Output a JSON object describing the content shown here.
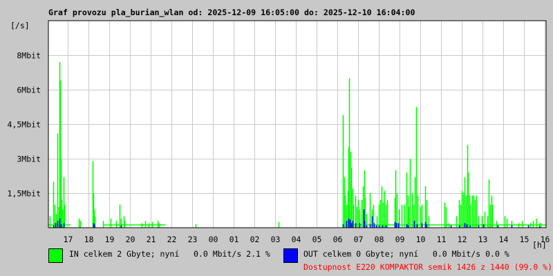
{
  "chart_data": {
    "type": "bar",
    "title": "Graf provozu pla_burian_wlan od: 2025-12-09 16:05:00 do: 2025-12-10 16:04:00",
    "ylabel": "[/s]",
    "xlabel": "[h]",
    "x_unit": "minutes since 16:05",
    "x_range": [
      0,
      1440
    ],
    "ylim": [
      0,
      9
    ],
    "y_ticks": [
      {
        "value": 1.5,
        "label": "1,5Mbit"
      },
      {
        "value": 3,
        "label": "3Mbit"
      },
      {
        "value": 4.5,
        "label": "4,5Mbit"
      },
      {
        "value": 6,
        "label": "6Mbit"
      },
      {
        "value": 7.5,
        "label": "8Mbit"
      }
    ],
    "x_ticks": [
      "17",
      "18",
      "19",
      "20",
      "21",
      "22",
      "23",
      "00",
      "01",
      "02",
      "03",
      "04",
      "05",
      "06",
      "07",
      "08",
      "09",
      "10",
      "11",
      "12",
      "13",
      "14",
      "15",
      "16"
    ],
    "grid": true,
    "colors": {
      "in": "#00ff00",
      "out": "#0000ff",
      "availability": "#ff0000",
      "grid": "#c8c8c8",
      "background": "#c8c8c8"
    },
    "series": [
      {
        "name": "IN",
        "baseline": [
          [
            0,
            64,
            0.12
          ],
          [
            160,
            340,
            0.12
          ],
          [
            850,
            1440,
            0.12
          ]
        ],
        "peaks": [
          [
            4,
            0.5
          ],
          [
            14,
            2.0
          ],
          [
            18,
            1.0
          ],
          [
            22,
            0.6
          ],
          [
            26,
            4.1
          ],
          [
            30,
            0.9
          ],
          [
            32,
            7.2
          ],
          [
            34,
            6.4
          ],
          [
            36,
            3.0
          ],
          [
            38,
            1.2
          ],
          [
            40,
            0.8
          ],
          [
            44,
            2.2
          ],
          [
            46,
            1.0
          ],
          [
            88,
            0.4
          ],
          [
            92,
            0.3
          ],
          [
            128,
            2.9
          ],
          [
            130,
            1.5
          ],
          [
            132,
            0.8
          ],
          [
            134,
            0.5
          ],
          [
            158,
            0.3
          ],
          [
            180,
            0.4
          ],
          [
            196,
            0.3
          ],
          [
            206,
            1.0
          ],
          [
            210,
            0.4
          ],
          [
            218,
            0.5
          ],
          [
            220,
            0.3
          ],
          [
            270,
            0.2
          ],
          [
            280,
            0.3
          ],
          [
            290,
            0.2
          ],
          [
            300,
            0.25
          ],
          [
            316,
            0.3
          ],
          [
            320,
            0.2
          ],
          [
            426,
            0.15
          ],
          [
            666,
            0.25
          ],
          [
            852,
            4.9
          ],
          [
            856,
            2.2
          ],
          [
            858,
            1.4
          ],
          [
            862,
            1.0
          ],
          [
            866,
            1.6
          ],
          [
            868,
            3.5
          ],
          [
            870,
            6.5
          ],
          [
            874,
            3.3
          ],
          [
            876,
            2.6
          ],
          [
            880,
            1.7
          ],
          [
            882,
            1.0
          ],
          [
            888,
            1.4
          ],
          [
            892,
            0.9
          ],
          [
            896,
            1.2
          ],
          [
            900,
            0.8
          ],
          [
            906,
            1.2
          ],
          [
            910,
            1.8
          ],
          [
            914,
            2.5
          ],
          [
            916,
            1.3
          ],
          [
            920,
            0.6
          ],
          [
            930,
            1.5
          ],
          [
            936,
            0.8
          ],
          [
            940,
            1.0
          ],
          [
            950,
            0.5
          ],
          [
            956,
            1.0
          ],
          [
            960,
            1.2
          ],
          [
            964,
            1.8
          ],
          [
            968,
            1.1
          ],
          [
            972,
            1.6
          ],
          [
            976,
            1.0
          ],
          [
            980,
            1.2
          ],
          [
            1002,
            1.3
          ],
          [
            1004,
            2.5
          ],
          [
            1008,
            1.5
          ],
          [
            1014,
            0.8
          ],
          [
            1022,
            1.0
          ],
          [
            1030,
            1.0
          ],
          [
            1036,
            2.4
          ],
          [
            1040,
            1.4
          ],
          [
            1042,
            0.9
          ],
          [
            1046,
            3.0
          ],
          [
            1052,
            1.5
          ],
          [
            1056,
            1.0
          ],
          [
            1060,
            2.2
          ],
          [
            1064,
            5.25
          ],
          [
            1068,
            1.4
          ],
          [
            1076,
            0.9
          ],
          [
            1080,
            1.0
          ],
          [
            1090,
            1.8
          ],
          [
            1094,
            1.2
          ],
          [
            1100,
            0.5
          ],
          [
            1146,
            1.1
          ],
          [
            1150,
            0.9
          ],
          [
            1158,
            0.2
          ],
          [
            1180,
            0.5
          ],
          [
            1188,
            1.2
          ],
          [
            1192,
            1.0
          ],
          [
            1196,
            1.6
          ],
          [
            1200,
            1.5
          ],
          [
            1204,
            2.2
          ],
          [
            1208,
            1.4
          ],
          [
            1212,
            3.6
          ],
          [
            1214,
            2.4
          ],
          [
            1218,
            1.4
          ],
          [
            1220,
            1.0
          ],
          [
            1226,
            1.4
          ],
          [
            1230,
            1.4
          ],
          [
            1234,
            1.2
          ],
          [
            1238,
            1.4
          ],
          [
            1244,
            0.5
          ],
          [
            1254,
            0.5
          ],
          [
            1262,
            0.7
          ],
          [
            1270,
            0.5
          ],
          [
            1274,
            2.1
          ],
          [
            1278,
            1.0
          ],
          [
            1282,
            1.4
          ],
          [
            1284,
            1.0
          ],
          [
            1296,
            0.3
          ],
          [
            1320,
            0.5
          ],
          [
            1326,
            0.4
          ],
          [
            1340,
            0.3
          ],
          [
            1360,
            0.2
          ],
          [
            1370,
            0.3
          ],
          [
            1394,
            0.2
          ],
          [
            1402,
            0.3
          ],
          [
            1412,
            0.4
          ],
          [
            1420,
            0.2
          ],
          [
            1424,
            0.2
          ]
        ]
      },
      {
        "name": "OUT",
        "baseline": [],
        "peaks": [
          [
            14,
            0.1
          ],
          [
            20,
            0.2
          ],
          [
            26,
            0.3
          ],
          [
            32,
            0.4
          ],
          [
            36,
            0.15
          ],
          [
            44,
            0.2
          ],
          [
            130,
            0.2
          ],
          [
            132,
            0.15
          ],
          [
            210,
            0.1
          ],
          [
            852,
            0.15
          ],
          [
            862,
            0.3
          ],
          [
            868,
            0.4
          ],
          [
            872,
            0.35
          ],
          [
            876,
            0.2
          ],
          [
            880,
            0.3
          ],
          [
            888,
            0.2
          ],
          [
            900,
            0.2
          ],
          [
            912,
            0.8
          ],
          [
            914,
            0.3
          ],
          [
            920,
            0.1
          ],
          [
            930,
            0.15
          ],
          [
            936,
            0.5
          ],
          [
            942,
            0.2
          ],
          [
            948,
            0.1
          ],
          [
            956,
            0.1
          ],
          [
            966,
            0.1
          ],
          [
            976,
            0.1
          ],
          [
            1002,
            0.25
          ],
          [
            1006,
            0.2
          ],
          [
            1012,
            0.2
          ],
          [
            1036,
            0.15
          ],
          [
            1040,
            0.1
          ],
          [
            1058,
            0.3
          ],
          [
            1066,
            0.15
          ],
          [
            1080,
            0.2
          ],
          [
            1090,
            0.25
          ],
          [
            1094,
            0.15
          ],
          [
            1164,
            0.1
          ],
          [
            1188,
            0.1
          ],
          [
            1204,
            0.2
          ],
          [
            1210,
            0.15
          ],
          [
            1220,
            0.1
          ],
          [
            1244,
            0.1
          ],
          [
            1258,
            0.15
          ],
          [
            1300,
            0.1
          ],
          [
            1340,
            0.1
          ],
          [
            1388,
            0.1
          ],
          [
            1420,
            0.05
          ]
        ]
      }
    ]
  },
  "legend": {
    "in_text": "IN celkem 2 Gbyte; nyní   0.0 Mbit/s 2.1 %",
    "out_text": "OUT celkem 0 Gbyte; nyní   0.0 Mbit/s 0.0 %",
    "availability": "Dostupnost E220 KOMPAKTOR semik 1426 z 1440 (99.0 %)"
  }
}
